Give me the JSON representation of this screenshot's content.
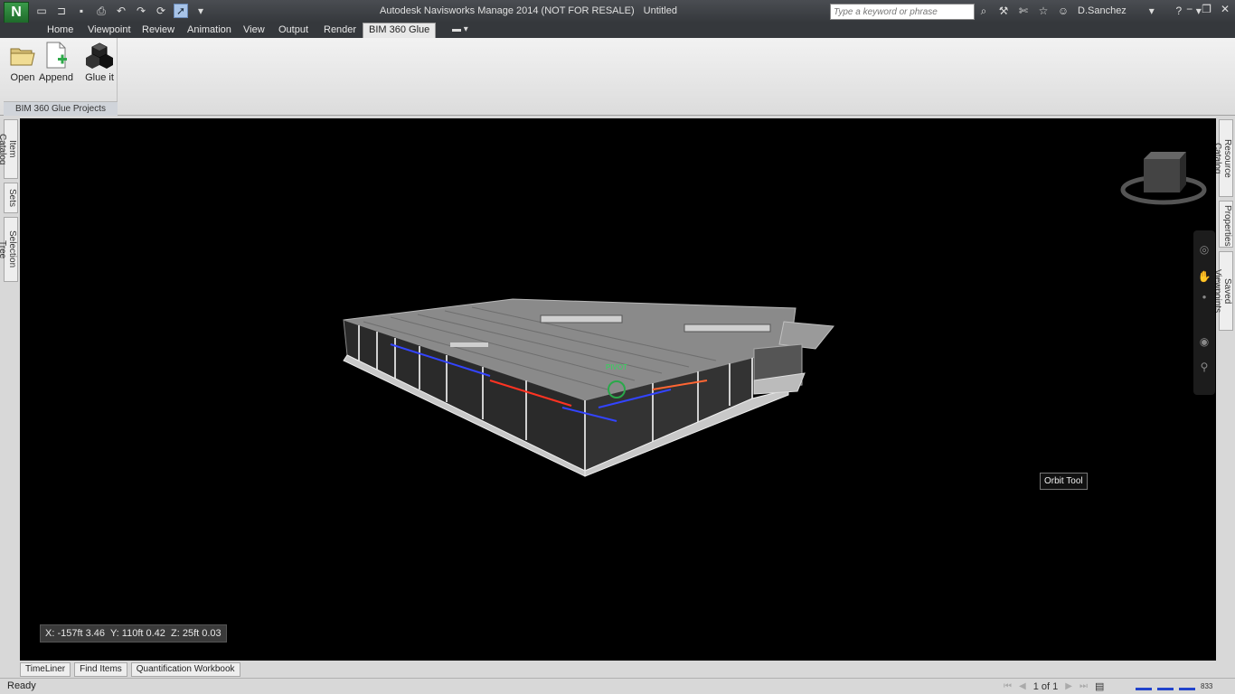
{
  "titlebar": {
    "app_name": "Autodesk Navisworks Manage 2014 (NOT FOR RESALE)",
    "document": "Untitled",
    "logo_letter": "N",
    "search_placeholder": "Type a keyword or phrase",
    "user": "D.Sanchez"
  },
  "menu": {
    "tabs": [
      "Home",
      "Viewpoint",
      "Review",
      "Animation",
      "View",
      "Output",
      "Render",
      "BIM 360 Glue"
    ],
    "active_tab": "BIM 360 Glue"
  },
  "ribbon": {
    "panel_label": "BIM 360 Glue Projects",
    "buttons": {
      "open": "Open",
      "append": "Append",
      "glue_it": "Glue it"
    }
  },
  "left_tabs": [
    "Item Catalog",
    "Sets",
    "Selection Tree"
  ],
  "right_tabs": [
    "Resource Catalog",
    "Properties",
    "Saved Viewpoints"
  ],
  "viewport": {
    "coordinates": "X: -157ft 3.46  Y: 110ft 0.42  Z: 25ft 0.03",
    "tooltip": "Orbit Tool",
    "pivot_label": "PIVOT"
  },
  "bottom_tabs": [
    "TimeLiner",
    "Find Items",
    "Quantification Workbook"
  ],
  "status": {
    "text": "Ready",
    "page": "1 of 1",
    "memory": "833"
  },
  "colors": {
    "accent": "#3a9a4a",
    "titlebar": "#35383c",
    "viewport_bg": "#000000"
  },
  "icons": {
    "new": "new-file-icon",
    "open": "open-folder-icon",
    "save": "save-icon",
    "print": "print-icon",
    "undo": "undo-icon",
    "redo": "redo-icon",
    "refresh": "refresh-icon",
    "select": "select-arrow-icon"
  }
}
